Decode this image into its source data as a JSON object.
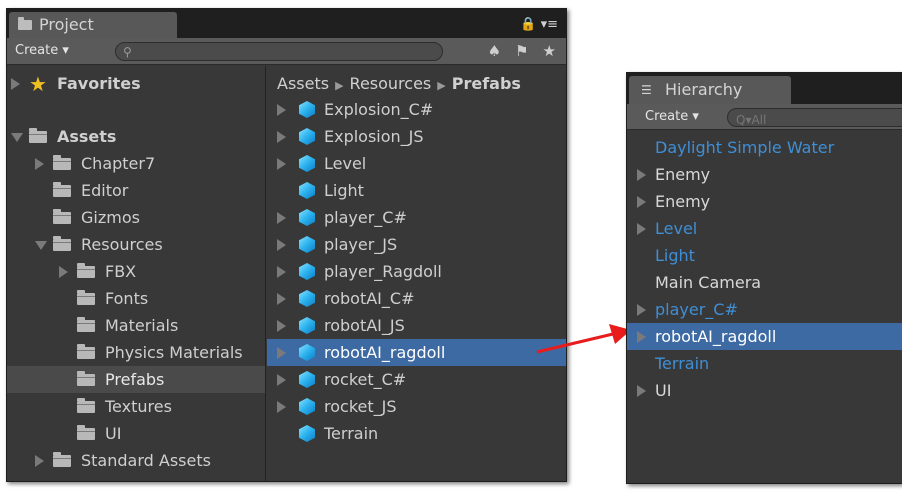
{
  "project": {
    "tab_title": "Project",
    "title_right": "🔒 ▾≡",
    "create_label": "Create ▾",
    "search_placeholder": "",
    "breadcrumb": [
      "Assets",
      "Resources",
      "Prefabs"
    ],
    "favorites_label": "Favorites",
    "tree": [
      {
        "label": "Assets"
      },
      {
        "label": "Chapter7"
      },
      {
        "label": "Editor"
      },
      {
        "label": "Gizmos"
      },
      {
        "label": "Resources"
      },
      {
        "label": "FBX"
      },
      {
        "label": "Fonts"
      },
      {
        "label": "Materials"
      },
      {
        "label": "Physics Materials"
      },
      {
        "label": "Prefabs"
      },
      {
        "label": "Textures"
      },
      {
        "label": "UI"
      },
      {
        "label": "Standard Assets"
      }
    ],
    "prefabs": [
      {
        "label": "Explosion_C#"
      },
      {
        "label": "Explosion_JS"
      },
      {
        "label": "Level"
      },
      {
        "label": "Light"
      },
      {
        "label": "player_C#"
      },
      {
        "label": "player_JS"
      },
      {
        "label": "player_Ragdoll"
      },
      {
        "label": "robotAI_C#"
      },
      {
        "label": "robotAI_JS"
      },
      {
        "label": "robotAI_ragdoll"
      },
      {
        "label": "rocket_C#"
      },
      {
        "label": "rocket_JS"
      },
      {
        "label": "Terrain"
      }
    ]
  },
  "hierarchy": {
    "tab_title": "Hierarchy",
    "create_label": "Create ▾",
    "search_placeholder": "Q▾All",
    "items": [
      {
        "label": "Daylight Simple Water"
      },
      {
        "label": "Enemy"
      },
      {
        "label": "Enemy"
      },
      {
        "label": "Level"
      },
      {
        "label": "Light"
      },
      {
        "label": "Main Camera"
      },
      {
        "label": "player_C#"
      },
      {
        "label": "robotAI_ragdoll"
      },
      {
        "label": "Terrain"
      },
      {
        "label": "UI"
      }
    ]
  },
  "colors": {
    "selection": "#3d6aa2",
    "prefab_text": "#3f8fd6",
    "panel": "#383838",
    "arrow": "#e81c1c"
  }
}
